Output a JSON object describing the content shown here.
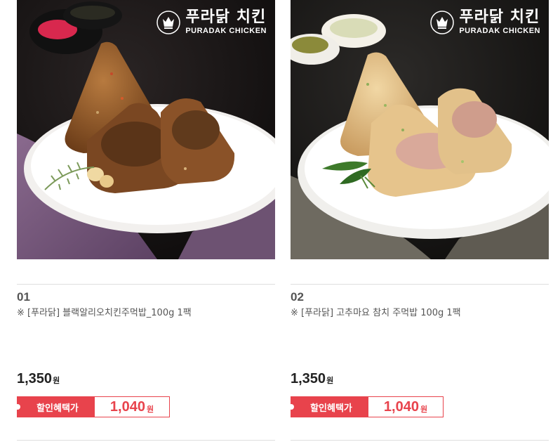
{
  "brand": {
    "name_ko": "푸라닭 치킨",
    "name_en": "PURADAK CHICKEN",
    "emblem_icon": "crown-shield-icon"
  },
  "products": [
    {
      "number": "01",
      "name": "※ [푸라닭] 블랙알리오치킨주먹밥_100g 1팩",
      "price": "1,350",
      "currency": "원",
      "sale_label": "할인혜택가",
      "sale_price": "1,040",
      "image_theme": "dark-soy-rice-balls"
    },
    {
      "number": "02",
      "name": "※ [푸라닭] 고추마요 참치 주먹밥 100g 1팩",
      "price": "1,350",
      "currency": "원",
      "sale_label": "할인혜택가",
      "sale_price": "1,040",
      "image_theme": "tuna-mayo-rice-balls"
    }
  ],
  "colors": {
    "sale_red": "#e8434c",
    "divider": "#dedede"
  }
}
